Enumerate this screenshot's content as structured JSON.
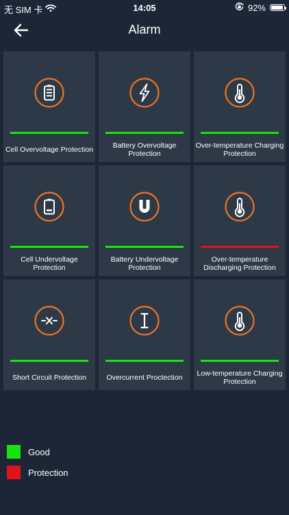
{
  "status_bar": {
    "carrier": "无 SIM 卡",
    "time": "14:05",
    "battery_percent": "92%",
    "battery_level": 0.92
  },
  "nav": {
    "title": "Alarm"
  },
  "colors": {
    "good": "#17e30e",
    "protection": "#e2111a",
    "accent": "#ee7424",
    "tile_bg": "#2e3948",
    "page_bg": "#1c2637"
  },
  "tiles": [
    {
      "label": "Cell Overvoltage Protection",
      "icon": "battery-full-icon",
      "status": "good"
    },
    {
      "label": "Battery Overvoltage Protection",
      "icon": "lightning-icon",
      "status": "good"
    },
    {
      "label": "Over-temperature Charging Protection",
      "icon": "thermometer-icon",
      "status": "good"
    },
    {
      "label": "Cell Undervoltage Protection",
      "icon": "battery-low-icon",
      "status": "good"
    },
    {
      "label": "Battery Undervoltage Protection",
      "icon": "magnet-icon",
      "status": "good"
    },
    {
      "label": "Over-temperature Discharging Protection",
      "icon": "thermometer-icon",
      "status": "protection"
    },
    {
      "label": "Short Circuit Protection",
      "icon": "short-circuit-icon",
      "status": "good"
    },
    {
      "label": "Overcurrent Proctection",
      "icon": "current-icon",
      "status": "good"
    },
    {
      "label": "Low-temperature Charging Protection",
      "icon": "thermometer-icon",
      "status": "good"
    }
  ],
  "legend": [
    {
      "label": "Good",
      "status": "good"
    },
    {
      "label": "Protection",
      "status": "protection"
    }
  ]
}
